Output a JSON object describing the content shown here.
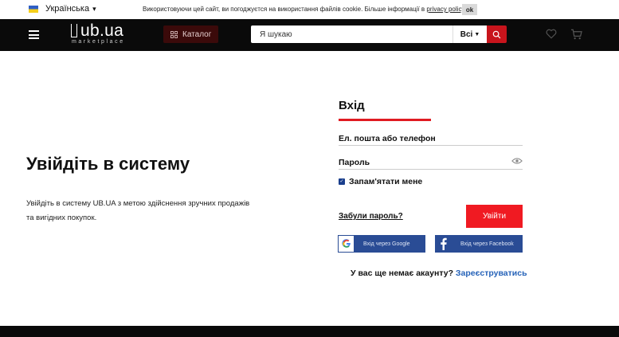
{
  "topbar": {
    "language": "Українська",
    "cookie_text": "Використовуючи цей сайт, ви погоджуєтся на використання файлів cookie. Більше інформації в",
    "cookie_link": "privacy policy",
    "cookie_end": ".",
    "ok_label": "ok"
  },
  "header": {
    "logo_main": "ub.ua",
    "logo_sub": "marketplace",
    "catalog_label": "Каталог",
    "search_placeholder": "Я шукаю",
    "filter_label": "Всі"
  },
  "left": {
    "title": "Увійдіть в систему",
    "description": "Увійдіть в систему UB.UA з метою здійснення зручних продажів та вигідних покупок."
  },
  "login": {
    "title": "Вхід",
    "email_placeholder": "Ел. пошта або телефон",
    "password_placeholder": "Пароль",
    "remember_label": "Запам'ятати мене",
    "remember_checked": true,
    "forgot_label": "Забули пароль?",
    "submit_label": "Увійти",
    "google_label": "Вхід через Google",
    "facebook_label": "Вхід через Facebook",
    "no_account_text": "У вас ще немає акаунту?",
    "register_label": "Зареєструватись"
  },
  "icons": {
    "menu": "menu-icon",
    "catalog": "grid-icon",
    "search": "search-icon",
    "wishlist": "heart-icon",
    "cart": "cart-icon",
    "password_toggle": "eye-icon",
    "google": "google-icon",
    "facebook": "facebook-icon"
  },
  "colors": {
    "brand_red": "#e01b22",
    "header_bg": "#0a0a0a",
    "social_blue": "#2a4c95",
    "link_blue": "#2562b8"
  }
}
